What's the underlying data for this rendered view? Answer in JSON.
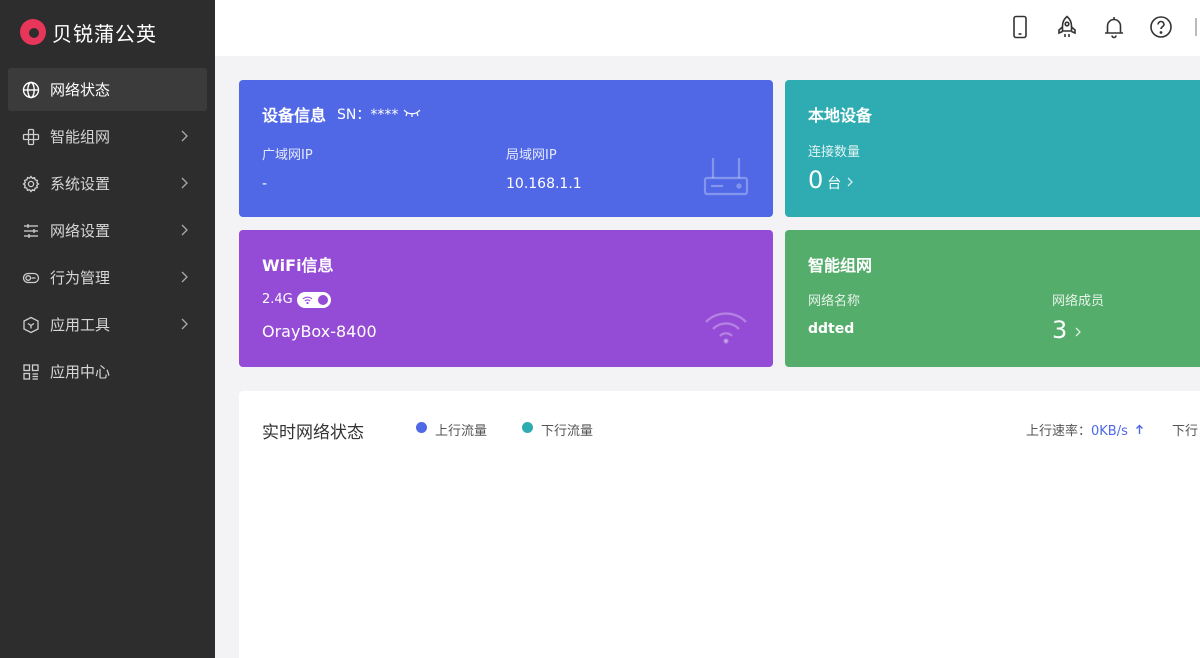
{
  "brand": {
    "name": "贝锐蒲公英"
  },
  "sidebar": {
    "items": [
      {
        "label": "网络状态",
        "icon": "globe-icon",
        "active": true,
        "has_arrow": false
      },
      {
        "label": "智能组网",
        "icon": "mesh-network-icon",
        "active": false,
        "has_arrow": true
      },
      {
        "label": "系统设置",
        "icon": "gear-icon",
        "active": false,
        "has_arrow": true
      },
      {
        "label": "网络设置",
        "icon": "sliders-icon",
        "active": false,
        "has_arrow": true
      },
      {
        "label": "行为管理",
        "icon": "toggle-icon",
        "active": false,
        "has_arrow": true
      },
      {
        "label": "应用工具",
        "icon": "box-icon",
        "active": false,
        "has_arrow": true
      },
      {
        "label": "应用中心",
        "icon": "apps-grid-icon",
        "active": false,
        "has_arrow": false
      }
    ]
  },
  "header": {
    "icons": [
      "mobile-icon",
      "rocket-icon",
      "bell-icon",
      "help-icon"
    ]
  },
  "device_info": {
    "title": "设备信息",
    "sn_label": "SN：****",
    "wan_label": "广域网IP",
    "wan_value": "-",
    "lan_label": "局域网IP",
    "lan_value": "10.168.1.1"
  },
  "local_devices": {
    "title": "本地设备",
    "count_label": "连接数量",
    "count_value": "0",
    "count_unit": "台"
  },
  "wifi_info": {
    "title": "WiFi信息",
    "band": "2.4G",
    "ssid": "OrayBox-8400"
  },
  "smart_mesh": {
    "title": "智能组网",
    "name_label": "网络名称",
    "name_value": "ddted",
    "members_label": "网络成员",
    "members_value": "3"
  },
  "realtime": {
    "title": "实时网络状态",
    "legend_up": "上行流量",
    "legend_down": "下行流量",
    "up_rate_label": "上行速率：",
    "up_rate_value": "0KB/s",
    "down_rate_label": "下行",
    "colors": {
      "up": "#5068e6",
      "down": "#2eacb1"
    }
  },
  "colors": {
    "sidebar_bg": "#2d2d2d",
    "device_card": "#5068e6",
    "local_card": "#2eacb1",
    "wifi_card": "#944bd6",
    "mesh_card": "#55ad6b",
    "brand_accent": "#e8365a"
  }
}
